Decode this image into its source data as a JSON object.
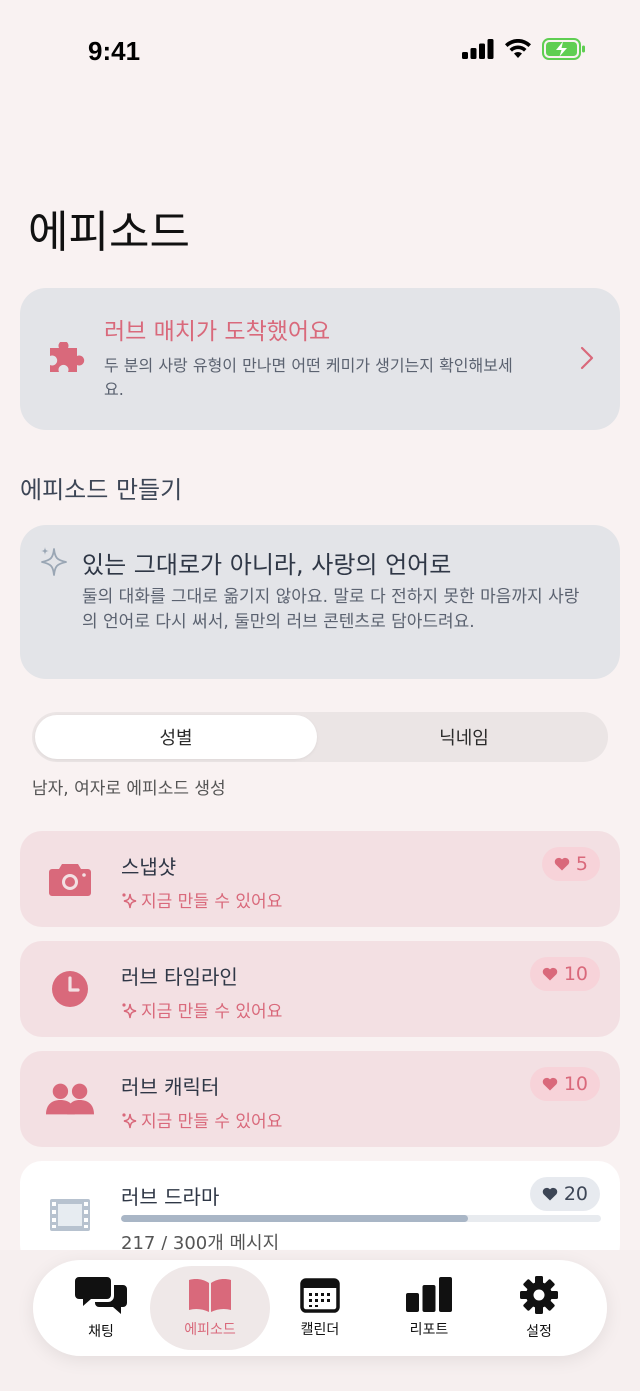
{
  "status": {
    "time": "9:41"
  },
  "page": {
    "title": "에피소드"
  },
  "love_match": {
    "title": "러브 매치가 도착했어요",
    "description": "두 분의 사랑 유형이 만나면 어떤 케미가 생기는지 확인해보세요."
  },
  "create_section": {
    "title": "에피소드 만들기",
    "intro_title": "있는 그대로가 아니라, 사랑의 언어로",
    "intro_desc": "둘의 대화를 그대로 옮기지 않아요. 말로 다 전하지 못한 마음까지 사랑의 언어로 다시 써서, 둘만의 러브 콘텐츠로 담아드려요."
  },
  "segment": {
    "options": [
      "성별",
      "닉네임"
    ],
    "selected": "성별",
    "caption": "남자, 여자로 에피소드 생성"
  },
  "episodes": [
    {
      "title": "스냅샷",
      "status": "지금 만들 수 있어요",
      "cost": "5",
      "icon": "camera-icon"
    },
    {
      "title": "러브 타임라인",
      "status": "지금 만들 수 있어요",
      "cost": "10",
      "icon": "clock-icon"
    },
    {
      "title": "러브 캐릭터",
      "status": "지금 만들 수 있어요",
      "cost": "10",
      "icon": "people-icon"
    },
    {
      "title": "러브 드라마",
      "progress_label": "217 / 300개 메시지",
      "progress": 0.723,
      "cost": "20",
      "icon": "film-icon"
    }
  ],
  "tabbar": {
    "items": [
      {
        "label": "채팅",
        "icon": "chat-icon"
      },
      {
        "label": "에피소드",
        "icon": "book-icon"
      },
      {
        "label": "캘린더",
        "icon": "calendar-icon"
      },
      {
        "label": "리포트",
        "icon": "bar-chart-icon"
      },
      {
        "label": "설정",
        "icon": "gear-icon"
      }
    ],
    "active": "에피소드"
  },
  "colors": {
    "accent": "#d9697b",
    "background": "#f9f2f2",
    "card": "#e3e4e8",
    "episode_card": "#f3e0e3"
  }
}
